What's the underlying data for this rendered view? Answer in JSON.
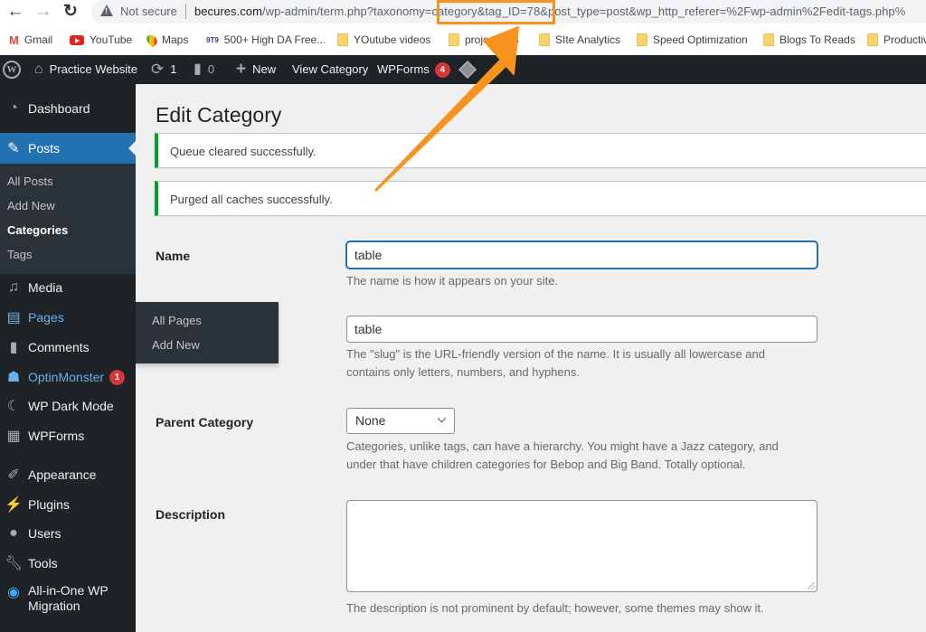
{
  "browser": {
    "back_icon": "←",
    "forward_icon": "→",
    "reload_icon": "↻",
    "security_label": "Not secure",
    "url_host": "becures.com",
    "url_path_before": "/wp-admin/term.php?taxonomy=",
    "url_highlighted": "category&tag_ID=78",
    "url_path_after": "&post_type=post&wp_http_referer=%2Fwp-admin%2Fedit-tags.php%",
    "highlight_color": "#f7941d",
    "bookmarks": [
      {
        "label": "Gmail",
        "icon": "gmail-icon"
      },
      {
        "label": "YouTube",
        "icon": "youtube-icon"
      },
      {
        "label": "Maps",
        "icon": "maps-icon"
      },
      {
        "label": "500+ High DA Free...",
        "icon": "ntn-icon"
      },
      {
        "label": "YOutube videos",
        "icon": "folder-icon"
      },
      {
        "label": "project $$$",
        "icon": "folder-icon"
      },
      {
        "label": "SIte Analytics",
        "icon": "folder-icon"
      },
      {
        "label": "Speed Optimization",
        "icon": "folder-icon"
      },
      {
        "label": "Blogs To Reads",
        "icon": "folder-icon"
      },
      {
        "label": "Productiv",
        "icon": "folder-icon"
      }
    ]
  },
  "adminbar": {
    "site_name": "Practice Website",
    "updates_count": "1",
    "comments_count": "0",
    "new_label": "New",
    "view_label": "View Category",
    "wpforms_label": "WPForms",
    "wpforms_badge": "4"
  },
  "sidebar": {
    "dashboard": "Dashboard",
    "posts": "Posts",
    "posts_sub": [
      "All Posts",
      "Add New",
      "Categories",
      "Tags"
    ],
    "media": "Media",
    "pages": "Pages",
    "comments": "Comments",
    "optinmonster": "OptinMonster",
    "optinmonster_badge": "1",
    "darkmode": "WP Dark Mode",
    "wpforms": "WPForms",
    "appearance": "Appearance",
    "plugins": "Plugins",
    "users": "Users",
    "tools": "Tools",
    "migration_line1": "All-in-One WP",
    "migration_line2": "Migration"
  },
  "pages_flyout": [
    "All Pages",
    "Add New"
  ],
  "main": {
    "title": "Edit Category",
    "notices": [
      "Queue cleared successfully.",
      "Purged all caches successfully."
    ],
    "name_label": "Name",
    "name_value": "table",
    "name_help": "The name is how it appears on your site.",
    "slug_value": "table",
    "slug_help_1": "The \"slug\" is the URL-friendly version of the name. It is usually all lowercase and",
    "slug_help_2": "contains only letters, numbers, and hyphens.",
    "parent_label": "Parent Category",
    "parent_value": "None",
    "parent_help_1": "Categories, unlike tags, can have a hierarchy. You might have a Jazz category, and",
    "parent_help_2": "under that have children categories for Bebop and Big Band. Totally optional.",
    "description_label": "Description",
    "description_value": "",
    "description_help": "The description is not prominent by default; however, some themes may show it."
  }
}
